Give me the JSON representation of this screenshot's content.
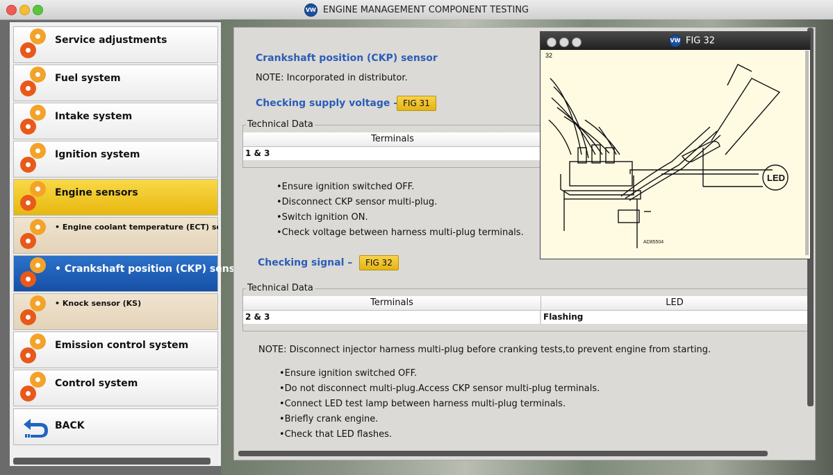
{
  "window": {
    "title": "ENGINE MANAGEMENT COMPONENT TESTING",
    "logo_icon": "vw-logo-icon"
  },
  "sidebar": {
    "items": [
      {
        "label": "Service adjustments",
        "icon": "gears-icon",
        "state": "normal"
      },
      {
        "label": "Fuel system",
        "icon": "gears-icon",
        "state": "normal"
      },
      {
        "label": "Intake system",
        "icon": "gears-icon",
        "state": "normal"
      },
      {
        "label": "Ignition system",
        "icon": "gears-icon",
        "state": "normal"
      },
      {
        "label": "Engine sensors",
        "icon": "gears-icon",
        "state": "active-group"
      },
      {
        "label": "• Engine coolant temperature (ECT) senso",
        "icon": "gears-icon",
        "state": "sub"
      },
      {
        "label": "• Crankshaft position (CKP) sensor",
        "icon": "gears-icon",
        "state": "selected"
      },
      {
        "label": "• Knock sensor (KS)",
        "icon": "gears-icon",
        "state": "sub"
      },
      {
        "label": "Emission control system",
        "icon": "gears-icon",
        "state": "normal"
      },
      {
        "label": "Control system",
        "icon": "gears-icon",
        "state": "normal"
      },
      {
        "label": "BACK",
        "icon": "back-arrow-icon",
        "state": "normal"
      }
    ]
  },
  "content": {
    "heading": "Crankshaft position (CKP) sensor",
    "note1": "NOTE: Incorporated in distributor.",
    "section1": {
      "heading": "Checking supply voltage –",
      "fig_button": "FIG 31",
      "legend": "Technical Data",
      "headers": [
        "Terminals"
      ],
      "rows": [
        [
          "1 & 3"
        ]
      ],
      "bullets": [
        "Ensure ignition switched OFF.",
        "Disconnect CKP sensor multi-plug.",
        "Switch ignition ON.",
        "Check voltage between harness multi-plug terminals."
      ]
    },
    "section2": {
      "heading": "Checking signal –",
      "fig_button": "FIG 32",
      "legend": "Technical Data",
      "headers": [
        "Terminals",
        "LED"
      ],
      "rows": [
        [
          "2 & 3",
          "Flashing"
        ]
      ],
      "note": "NOTE: Disconnect injector harness multi-plug before cranking tests,to prevent engine from starting.",
      "bullets": [
        "Ensure ignition switched OFF.",
        "Do not disconnect multi-plug.Access CKP sensor multi-plug terminals.",
        "Connect LED test lamp between harness multi-plug terminals.",
        "Briefly crank engine.",
        "Check that LED flashes."
      ]
    }
  },
  "figure_window": {
    "title": "FIG 32",
    "fig_number": "32",
    "led_label": "LED",
    "ref_code": "AD85504"
  },
  "colors": {
    "accent_blue": "#2a5db8",
    "selected_blue": "#1650a6",
    "highlight_yellow": "#e7b70e",
    "gear_orange": "#f3a32a"
  }
}
